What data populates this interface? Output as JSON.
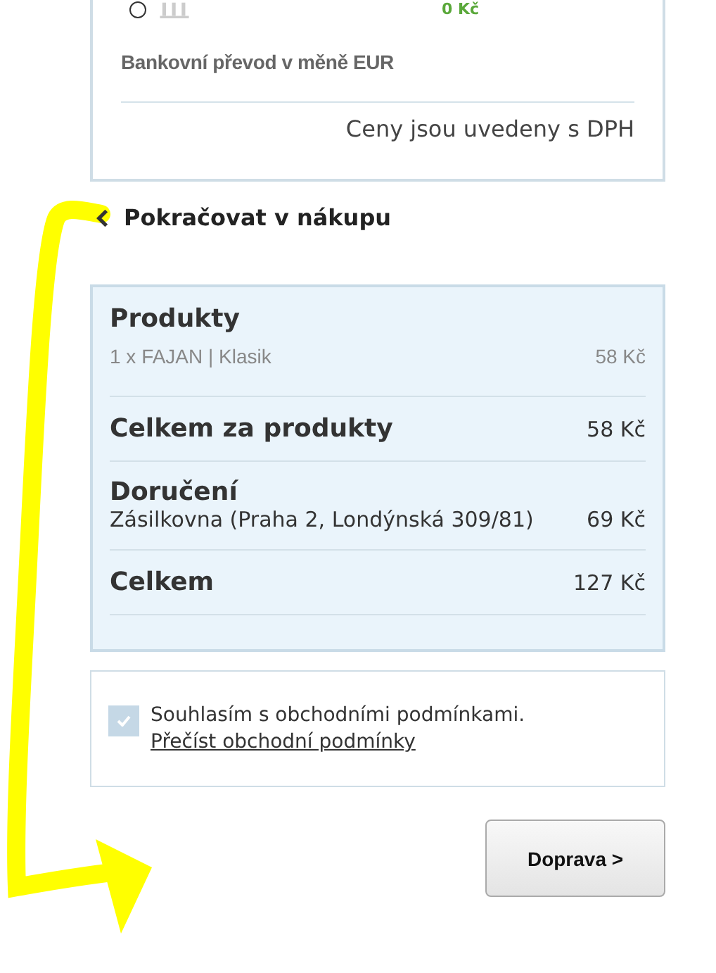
{
  "payment_option": {
    "selected": false,
    "price": "0 Kč",
    "label": "Bankovní převod v měně EUR"
  },
  "vat_note": "Ceny jsou uvedeny s DPH",
  "back_link": {
    "label": "Pokračovat v nákupu"
  },
  "summary": {
    "products_title": "Produkty",
    "products": [
      {
        "name": "1 x FAJAN | Klasik",
        "price": "58 Kč"
      }
    ],
    "products_total": {
      "label": "Celkem za produkty",
      "value": "58 Kč"
    },
    "delivery": {
      "title": "Doručení",
      "name": "Zásilkovna (Praha 2, Londýnská 309/81)",
      "price": "69 Kč"
    },
    "total": {
      "label": "Celkem",
      "value": "127 Kč"
    }
  },
  "terms": {
    "checked": true,
    "text": "Souhlasím s obchodními podmínkami.",
    "link": "Přečíst obchodní podmínky"
  },
  "next_button": {
    "label": "Doprava >"
  }
}
